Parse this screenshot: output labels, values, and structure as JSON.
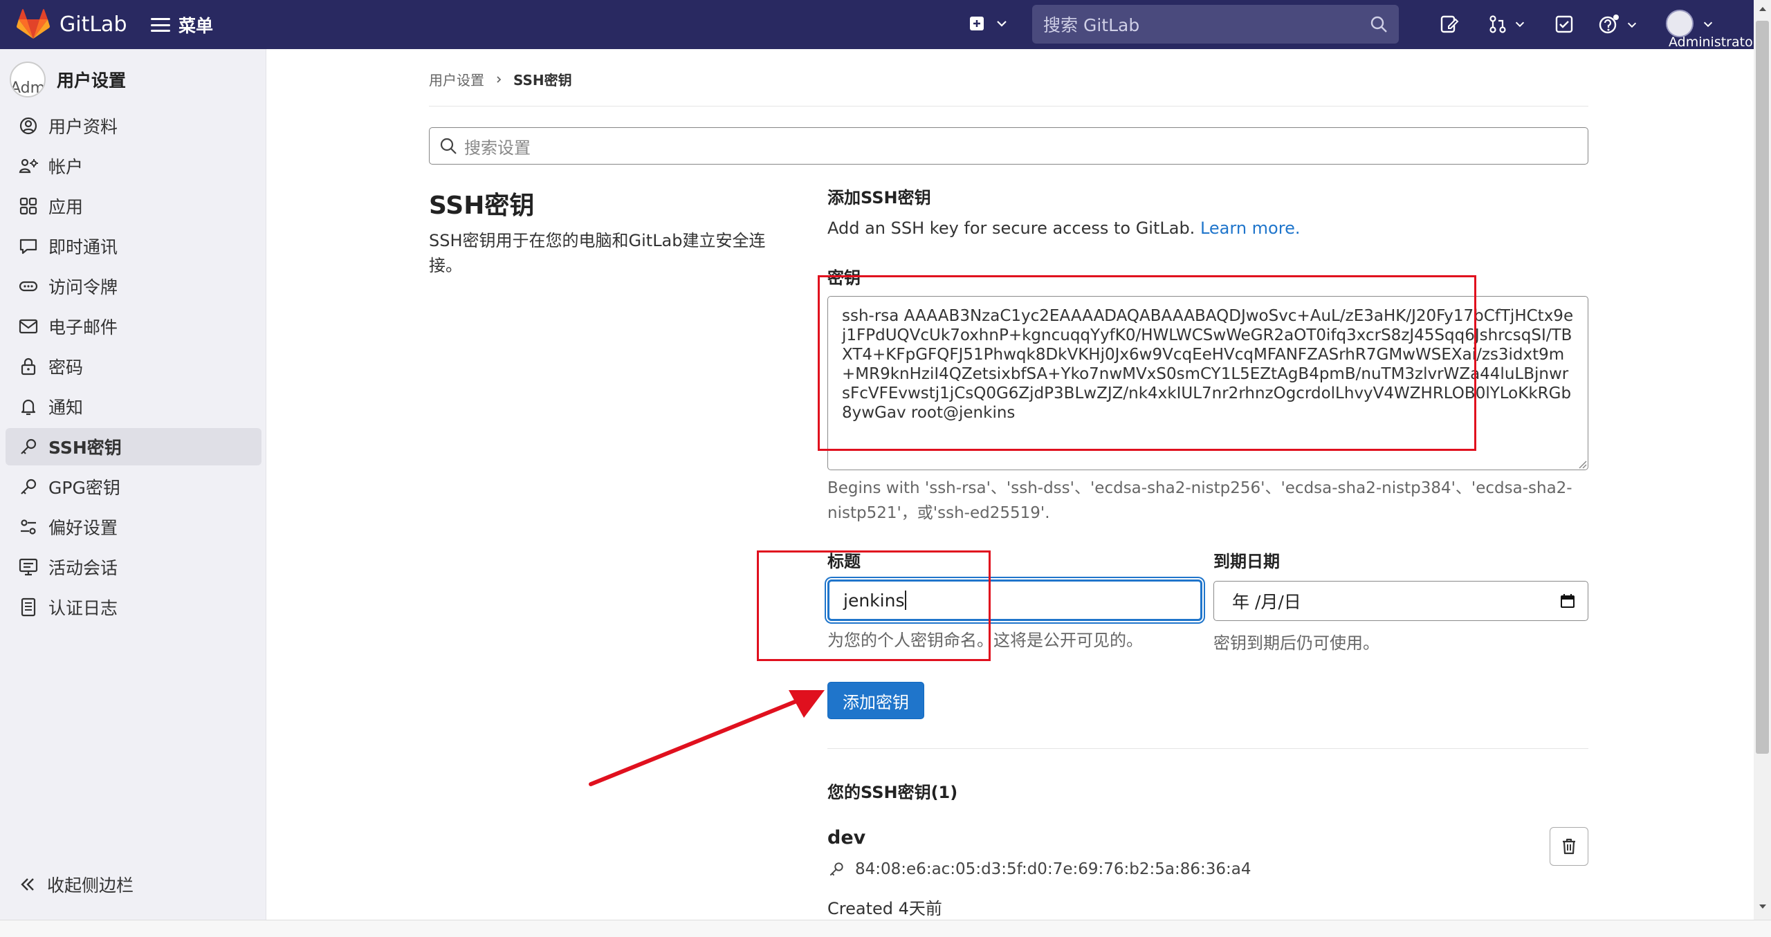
{
  "topbar": {
    "brand": "GitLab",
    "menu_label": "菜单",
    "search_placeholder": "搜索 GitLab",
    "user_label": "Administrato"
  },
  "sidebar": {
    "avatar_alt": "Adm",
    "title": "用户设置",
    "items": [
      {
        "label": "用户资料",
        "icon": "user-icon"
      },
      {
        "label": "帐户",
        "icon": "account-icon"
      },
      {
        "label": "应用",
        "icon": "applications-icon"
      },
      {
        "label": "即时通讯",
        "icon": "comment-icon"
      },
      {
        "label": "访问令牌",
        "icon": "token-icon"
      },
      {
        "label": "电子邮件",
        "icon": "mail-icon"
      },
      {
        "label": "密码",
        "icon": "lock-icon"
      },
      {
        "label": "通知",
        "icon": "bell-icon"
      },
      {
        "label": "SSH密钥",
        "icon": "key-icon",
        "active": true
      },
      {
        "label": "GPG密钥",
        "icon": "key-icon"
      },
      {
        "label": "偏好设置",
        "icon": "preferences-icon"
      },
      {
        "label": "活动会话",
        "icon": "monitor-icon"
      },
      {
        "label": "认证日志",
        "icon": "log-icon"
      }
    ],
    "collapse_label": "收起侧边栏"
  },
  "breadcrumb": {
    "parent": "用户设置",
    "current": "SSH密钥"
  },
  "search_settings": {
    "placeholder": "搜索设置"
  },
  "section": {
    "title": "SSH密钥",
    "description": "SSH密钥用于在您的电脑和GitLab建立安全连接。"
  },
  "add_form": {
    "title": "添加SSH密钥",
    "description": "Add an SSH key for secure access to GitLab.",
    "learn_more": "Learn more.",
    "key_label": "密钥",
    "key_value": "ssh-rsa AAAAB3NzaC1yc2EAAAADAQABAAABAQDJwoSvc+AuL/zE3aHK/J20Fy17bCfTjHCtx9ej1FPdUQVcUk7oxhnP+kgncuqqYyfK0/HWLWCSwWeGR2aOT0ifq3xcrS8zJ45Sqq6JshrcsqSI/TBXT4+KFpGFQFJ51Phwqk8DkVKHj0Jx6w9VcqEeHVcqMFANFZASrhR7GMwWSEXai/zs3idxt9m+MR9knHziI4QZetsixbfSA+Yko7nwMVxS0smCY1L5EZtAgB4pmB/nuTM3zlvrWZa44luLBjnwrsFcVFEvwstj1jCsQ0G6ZjdP3BLwZJZ/nk4xkIUL7nr2rhnzOgcrdolLhvyV4WZHRLOB0lYLoKkRGb8ywGav root@jenkins",
    "key_help": "Begins with 'ssh-rsa'、'ssh-dss'、'ecdsa-sha2-nistp256'、'ecdsa-sha2-nistp384'、'ecdsa-sha2-nistp521'，或'ssh-ed25519'.",
    "title_label": "标题",
    "title_value": "jenkins",
    "title_help": "为您的个人密钥命名。这将是公开可见的。",
    "expires_label": "到期日期",
    "expires_placeholder": "年 /月/日",
    "expires_help": "密钥到期后仍可使用。",
    "submit_label": "添加密钥"
  },
  "keys_list": {
    "title": "您的SSH密钥(1)",
    "keys": [
      {
        "name": "dev",
        "fingerprint": "84:08:e6:ac:05:d3:5f:d0:7e:69:76:b2:5a:86:36:a4",
        "created": "Created 4天前"
      }
    ]
  },
  "colors": {
    "topbar": "#292961",
    "primary": "#1f75cb",
    "annotation": "#e0101e"
  }
}
